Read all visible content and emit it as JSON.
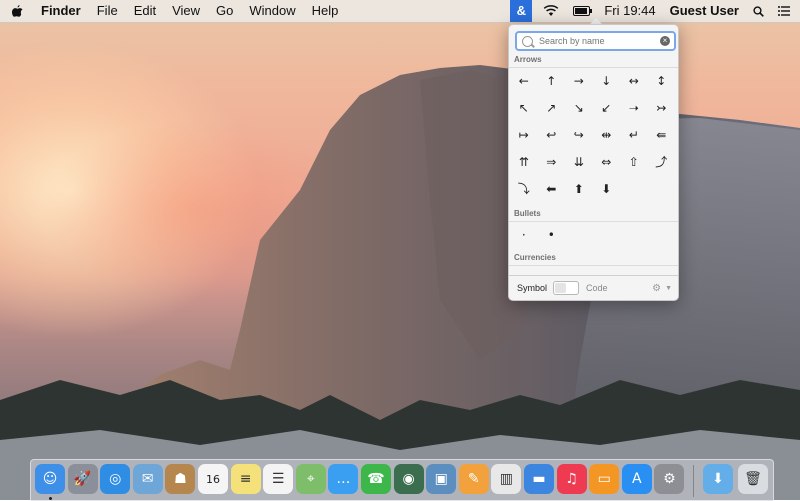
{
  "menubar": {
    "apple_icon": "apple-icon",
    "app_name": "Finder",
    "menus": [
      "File",
      "Edit",
      "View",
      "Go",
      "Window",
      "Help"
    ],
    "character_viewer_label": "&",
    "clock": "Fri 19:44",
    "user": "Guest User"
  },
  "character_viewer": {
    "search_placeholder": "Search by name",
    "sections": [
      {
        "title": "Arrows",
        "chars": [
          "←",
          "↑",
          "→",
          "↓",
          "↔",
          "↕",
          "↖",
          "↗",
          "↘",
          "↙",
          "➝",
          "↣",
          "↦",
          "↩",
          "↪",
          "⇹",
          "↵",
          "⇚",
          "⇈",
          "⇒",
          "⇊",
          "⇔",
          "⇧",
          "⤴",
          "⤵",
          "⬅",
          "⬆",
          "⬇"
        ]
      },
      {
        "title": "Bullets",
        "chars": [
          "·",
          "•"
        ]
      },
      {
        "title": "Currencies",
        "chars": []
      }
    ],
    "footer": {
      "symbol_label": "Symbol",
      "code_label": "Code"
    }
  },
  "dock": {
    "apps": [
      {
        "name": "Finder",
        "color": "#3e8fe8",
        "glyph": "☺"
      },
      {
        "name": "Launchpad",
        "color": "#8a8f99",
        "glyph": "🚀"
      },
      {
        "name": "Safari",
        "color": "#2f8de4",
        "glyph": "◎"
      },
      {
        "name": "Mail",
        "color": "#6fa6d8",
        "glyph": "✉"
      },
      {
        "name": "Contacts",
        "color": "#b5874e",
        "glyph": "☗"
      },
      {
        "name": "Calendar",
        "color": "#f5f5f5",
        "glyph": "16",
        "dark": true
      },
      {
        "name": "Notes",
        "color": "#f5e17a",
        "glyph": "≡",
        "dark": true
      },
      {
        "name": "Reminders",
        "color": "#f4f4f4",
        "glyph": "☰",
        "dark": true
      },
      {
        "name": "Maps",
        "color": "#7ebe6a",
        "glyph": "⌖"
      },
      {
        "name": "Messages",
        "color": "#3a9ff0",
        "glyph": "…"
      },
      {
        "name": "FaceTime",
        "color": "#3db64a",
        "glyph": "☎"
      },
      {
        "name": "Photo Booth",
        "color": "#3b6e4f",
        "glyph": "◉"
      },
      {
        "name": "iPhoto",
        "color": "#5c8fbf",
        "glyph": "▣"
      },
      {
        "name": "Pages",
        "color": "#f2a13c",
        "glyph": "✎"
      },
      {
        "name": "Numbers",
        "color": "#e8e8e8",
        "glyph": "▥",
        "dark": true
      },
      {
        "name": "Keynote",
        "color": "#3d86e0",
        "glyph": "▬"
      },
      {
        "name": "iTunes",
        "color": "#ef3b52",
        "glyph": "♫"
      },
      {
        "name": "iBooks",
        "color": "#f39624",
        "glyph": "▭"
      },
      {
        "name": "App Store",
        "color": "#2a8ff2",
        "glyph": "A"
      },
      {
        "name": "System Preferences",
        "color": "#8d8f95",
        "glyph": "⚙"
      },
      {
        "name": "Downloads",
        "color": "#63aee8",
        "glyph": "⬇"
      },
      {
        "name": "Trash",
        "color": "#d9dde2",
        "glyph": "🗑",
        "dark": true
      }
    ]
  }
}
